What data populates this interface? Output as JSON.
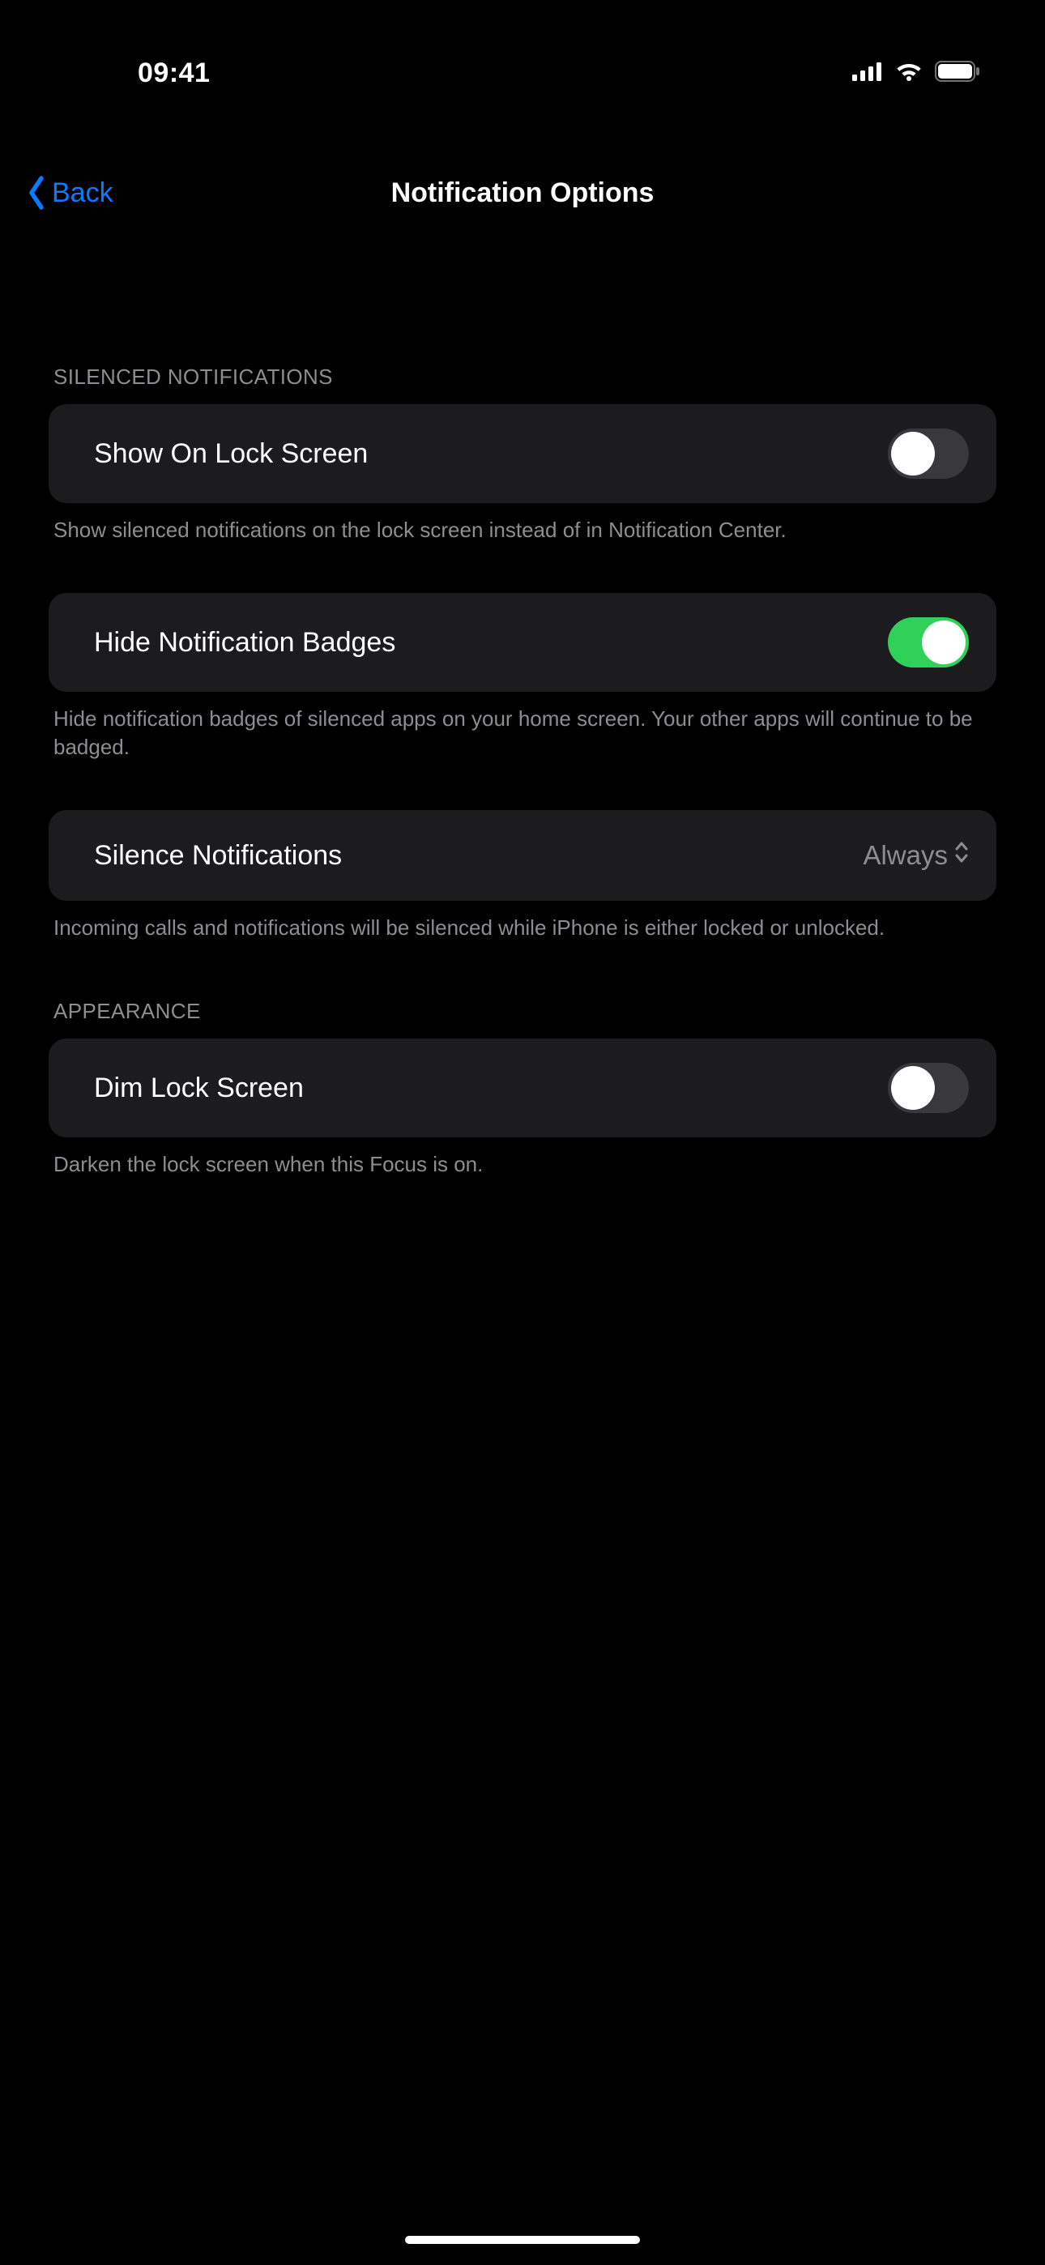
{
  "status": {
    "time": "09:41"
  },
  "nav": {
    "back_label": "Back",
    "title": "Notification Options"
  },
  "sections": {
    "silenced_header": "SILENCED NOTIFICATIONS",
    "show_on_lock": {
      "label": "Show On Lock Screen",
      "value": false
    },
    "show_on_lock_footer": "Show silenced notifications on the lock screen instead of in Notification Center.",
    "hide_badges": {
      "label": "Hide Notification Badges",
      "value": true
    },
    "hide_badges_footer": "Hide notification badges of silenced apps on your home screen. Your other apps will continue to be badged.",
    "silence": {
      "label": "Silence Notifications",
      "value": "Always"
    },
    "silence_footer": "Incoming calls and notifications will be silenced while iPhone is either locked or unlocked.",
    "appearance_header": "APPEARANCE",
    "dim_lock": {
      "label": "Dim Lock Screen",
      "value": false
    },
    "dim_lock_footer": "Darken the lock screen when this Focus is on."
  }
}
